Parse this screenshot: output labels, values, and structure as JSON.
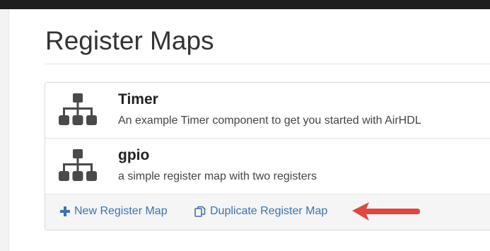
{
  "page": {
    "title": "Register Maps"
  },
  "register_maps": [
    {
      "name": "Timer",
      "description": "An example Timer component to get you started with AirHDL",
      "icon": "sitemap-icon"
    },
    {
      "name": "gpio",
      "description": "a simple register map with two registers",
      "icon": "sitemap-icon"
    }
  ],
  "footer": {
    "new_label": "New Register Map",
    "new_icon": "plus-icon",
    "duplicate_label": "Duplicate Register Map",
    "duplicate_icon": "copy-icon"
  },
  "colors": {
    "link": "#3a72b0",
    "annotation_arrow": "#e0473f",
    "icon": "#4a4a4a"
  }
}
